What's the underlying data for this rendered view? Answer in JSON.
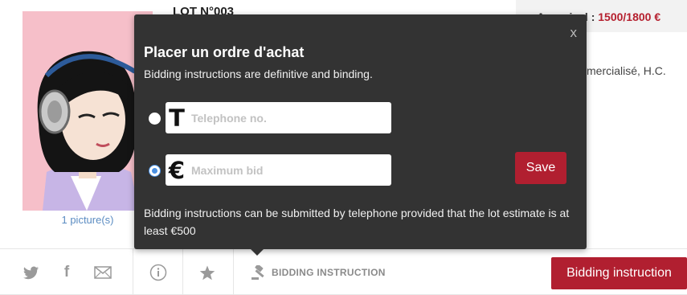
{
  "lot": {
    "number": "LOT N°003",
    "picture_count": "1 picture(s)",
    "estimate_label": "Appraisal : ",
    "estimate_value": "1500/1800 €",
    "description_fragment": "mercialisé, H.C."
  },
  "popover": {
    "close": "x",
    "title": "Placer un ordre d'achat",
    "subtitle": "Bidding instructions are definitive and binding.",
    "telephone": {
      "icon_glyph": "T",
      "placeholder": "Telephone no.",
      "value": "",
      "selected": false
    },
    "max_bid": {
      "icon_glyph": "€",
      "placeholder": "Maximum bid",
      "value": "",
      "selected": true
    },
    "save_label": "Save",
    "note": "Bidding instructions can be submitted by telephone provided that the lot estimate is at least €500"
  },
  "action_bar": {
    "icons": [
      "twitter-icon",
      "facebook-icon",
      "mail-icon",
      "info-icon",
      "star-icon",
      "gavel-icon"
    ],
    "bidding_link_label": "BIDDING INSTRUCTION",
    "bidding_button_label": "Bidding instruction"
  },
  "colors": {
    "accent_red": "#b11f30",
    "popover_bg": "#333333",
    "radio_blue": "#4a90e2",
    "link_blue": "#5b8cc2"
  }
}
